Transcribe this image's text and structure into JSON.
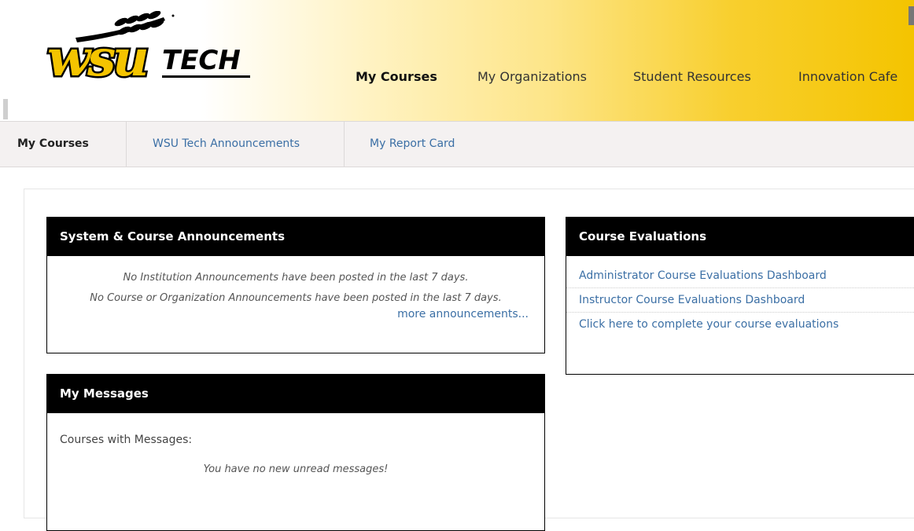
{
  "logo": {
    "brand": "wsu",
    "product": "TECH"
  },
  "topnav": {
    "items": [
      {
        "label": "My Courses",
        "active": true
      },
      {
        "label": "My Organizations",
        "active": false
      },
      {
        "label": "Student Resources",
        "active": false
      },
      {
        "label": "Innovation Cafe",
        "active": false
      }
    ]
  },
  "tabs": [
    {
      "label": "My Courses",
      "active": true
    },
    {
      "label": "WSU Tech Announcements",
      "active": false
    },
    {
      "label": "My Report Card",
      "active": false
    }
  ],
  "announcements": {
    "title": "System & Course Announcements",
    "institution_msg": "No Institution Announcements have been posted in the last 7 days.",
    "course_msg": "No Course or Organization Announcements have been posted in the last 7 days.",
    "more_link": "more announcements..."
  },
  "evaluations": {
    "title": "Course Evaluations",
    "links": [
      "Administrator Course Evaluations Dashboard",
      "Instructor Course Evaluations Dashboard",
      "Click here to complete your course evaluations"
    ]
  },
  "messages": {
    "title": "My Messages",
    "label": "Courses with Messages:",
    "empty": "You have no new unread messages!"
  },
  "colors": {
    "brand_gold": "#f4c400",
    "link_blue": "#3b6fa5",
    "header_black": "#000000"
  }
}
